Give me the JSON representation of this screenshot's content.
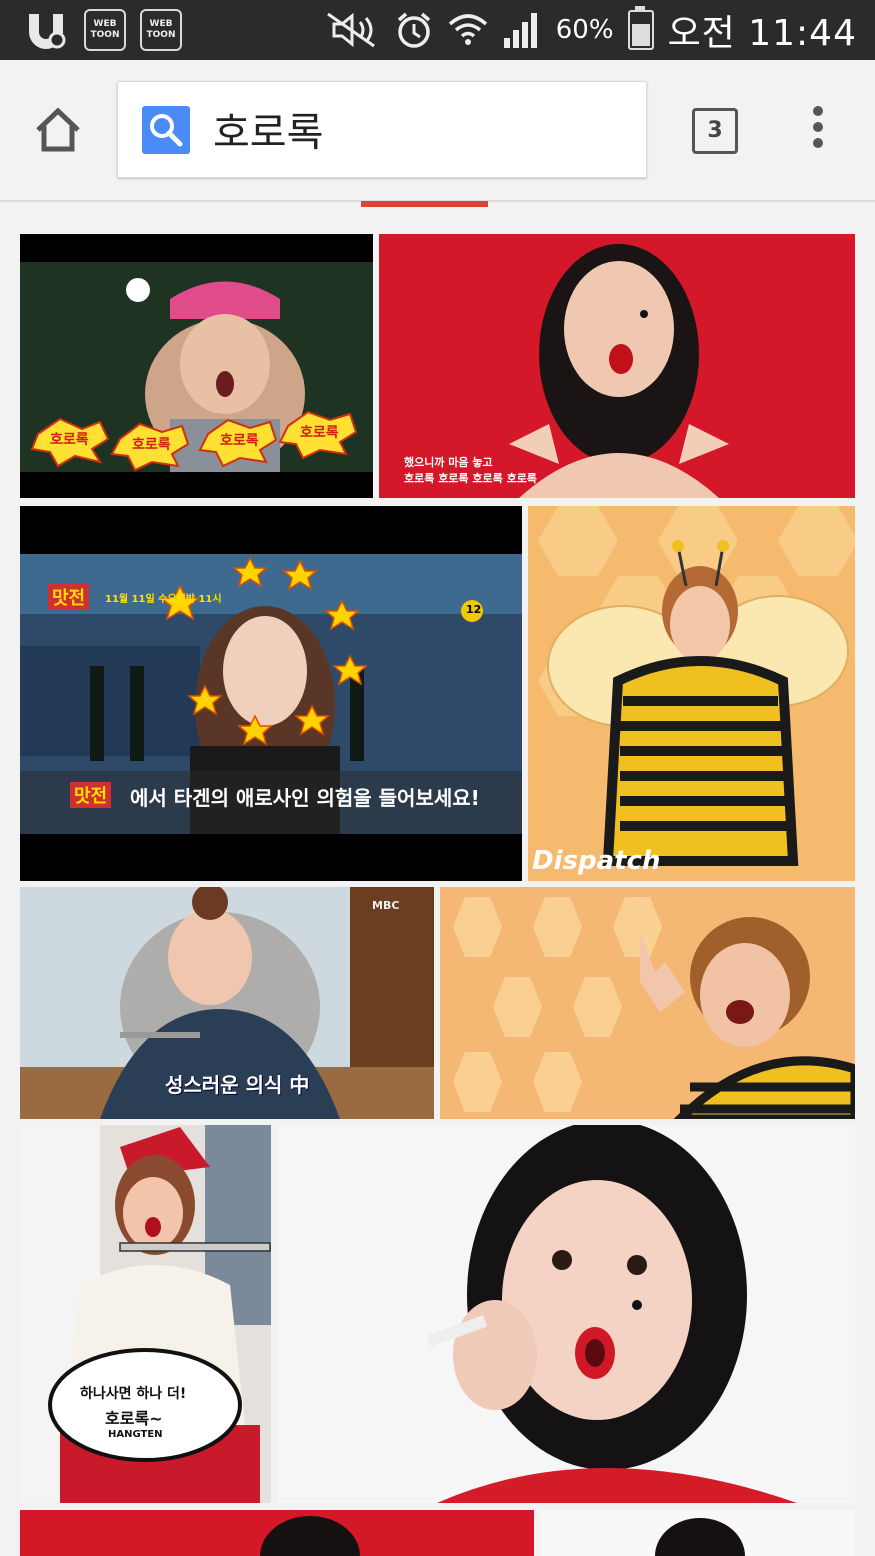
{
  "status_bar": {
    "webtoon_1": "WEB TOON",
    "webtoon_2": "WEB TOON",
    "battery": "60%",
    "time": "오전  11:44"
  },
  "toolbar": {
    "search_query": "호로록",
    "tab_count": "3"
  },
  "results": [
    {
      "id": 1,
      "caption": "호로록",
      "subtitle_1": "",
      "subtitle_2": ""
    },
    {
      "id": 2,
      "subtitle_1": "했으니까 마음 놓고",
      "subtitle_2": "호로록 호로록 호로록 호로록"
    },
    {
      "id": 3,
      "show": "맛전",
      "airdate": "11월 11일 수요일밤 11시",
      "rating": "12",
      "subtitle": "에서 타겐의 애로사인 의험을 들어보세요!"
    },
    {
      "id": 4,
      "watermark": "Dispatch"
    },
    {
      "id": 5,
      "network": "MBC",
      "subtitle": "성스러운 의식 中"
    },
    {
      "id": 6
    },
    {
      "id": 7,
      "bubble_1": "하나사면 하나 더!",
      "bubble_2": "호로록~",
      "brand": "HANGTEN"
    },
    {
      "id": 8
    },
    {
      "id": 9
    },
    {
      "id": 10
    }
  ]
}
